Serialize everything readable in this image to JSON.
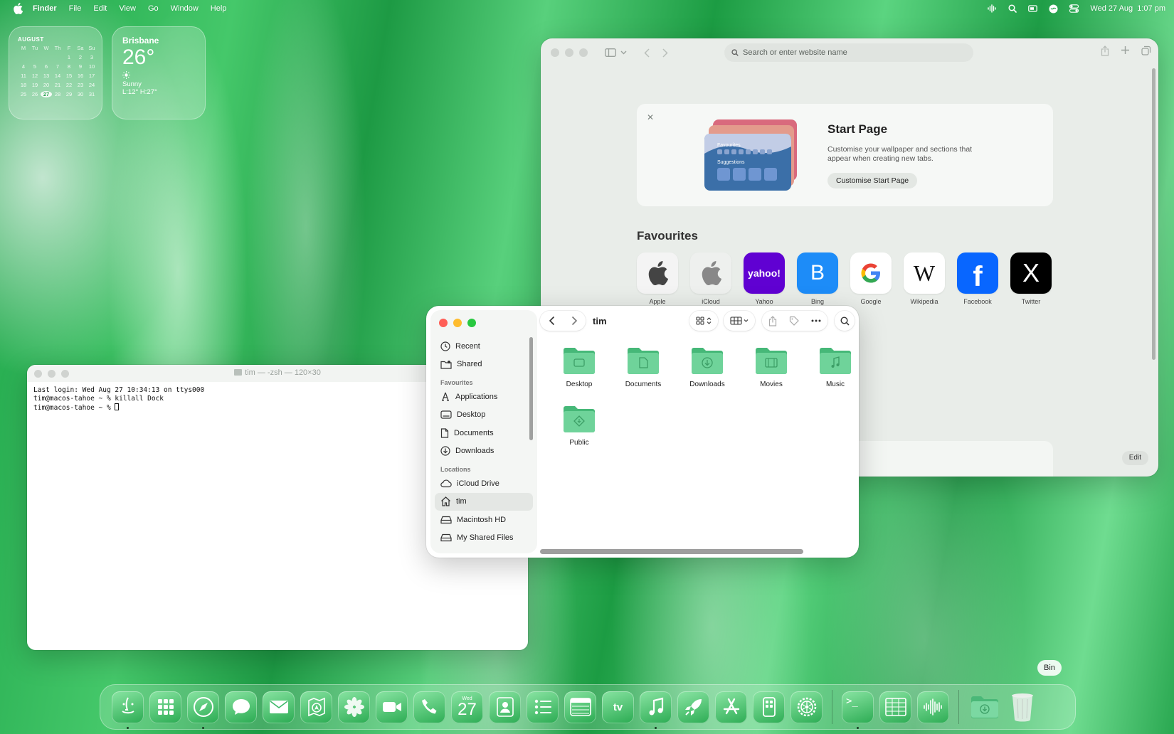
{
  "menubar": {
    "app_name": "Finder",
    "items": [
      "File",
      "Edit",
      "View",
      "Go",
      "Window",
      "Help"
    ],
    "datetime": "Wed 27 Aug  1:07 pm"
  },
  "calendar_widget": {
    "month": "AUGUST",
    "weekday_headers": [
      "M",
      "Tu",
      "W",
      "Th",
      "F",
      "Sa",
      "Su"
    ],
    "days": [
      "",
      "",
      "",
      "",
      "1",
      "2",
      "3",
      "4",
      "5",
      "6",
      "7",
      "8",
      "9",
      "10",
      "11",
      "12",
      "13",
      "14",
      "15",
      "16",
      "17",
      "18",
      "19",
      "20",
      "21",
      "22",
      "23",
      "24",
      "25",
      "26",
      "27",
      "28",
      "29",
      "30",
      "31"
    ],
    "today": "27"
  },
  "weather_widget": {
    "city": "Brisbane",
    "temperature": "26°",
    "condition": "Sunny",
    "hilo": "L:12° H:27°"
  },
  "safari": {
    "address_placeholder": "Search or enter website name",
    "start_page": {
      "title": "Start Page",
      "description": "Customise your wallpaper and sections that appear when creating new tabs.",
      "button": "Customise Start Page",
      "art_labels": [
        "Favourites",
        "Suggestions"
      ]
    },
    "favourites_title": "Favourites",
    "favourites": [
      {
        "label": "Apple",
        "icon": "apple-logo-icon"
      },
      {
        "label": "iCloud",
        "icon": "icloud-logo-icon"
      },
      {
        "label": "Yahoo",
        "icon": "yahoo-logo-icon",
        "tile_text": "yahoo!"
      },
      {
        "label": "Bing",
        "icon": "bing-logo-icon",
        "tile_text": "B"
      },
      {
        "label": "Google",
        "icon": "google-logo-icon"
      },
      {
        "label": "Wikipedia",
        "icon": "wikipedia-logo-icon",
        "tile_text": "W"
      },
      {
        "label": "Facebook",
        "icon": "facebook-logo-icon",
        "tile_text": "f"
      },
      {
        "label": "Twitter",
        "icon": "x-logo-icon",
        "tile_text": "X"
      }
    ],
    "edit_button": "Edit"
  },
  "terminal": {
    "title": "tim — -zsh — 120×30",
    "lines": [
      "Last login: Wed Aug 27 10:34:13 on ttys000",
      "tim@macos-tahoe ~ % killall Dock",
      "tim@macos-tahoe ~ % "
    ]
  },
  "finder": {
    "current_folder": "tim",
    "sidebar": {
      "top_items": [
        "Recent",
        "Shared"
      ],
      "favourites_heading": "Favourites",
      "favourites": [
        "Applications",
        "Desktop",
        "Documents",
        "Downloads"
      ],
      "locations_heading": "Locations",
      "locations": [
        "iCloud Drive",
        "tim",
        "Macintosh HD",
        "My Shared Files"
      ]
    },
    "folders": [
      "Desktop",
      "Documents",
      "Downloads",
      "Movies",
      "Music",
      "Public"
    ]
  },
  "dock": {
    "tooltip": "Bin",
    "calendar_weekday": "Wed",
    "calendar_day": "27"
  },
  "colors": {
    "close": "#ff5f57",
    "minimize": "#febc2e",
    "zoom": "#28c840",
    "folder_green": "#5fc88a",
    "yahoo": "#6001d2",
    "bing": "#1d8cf8",
    "facebook": "#0866ff"
  }
}
